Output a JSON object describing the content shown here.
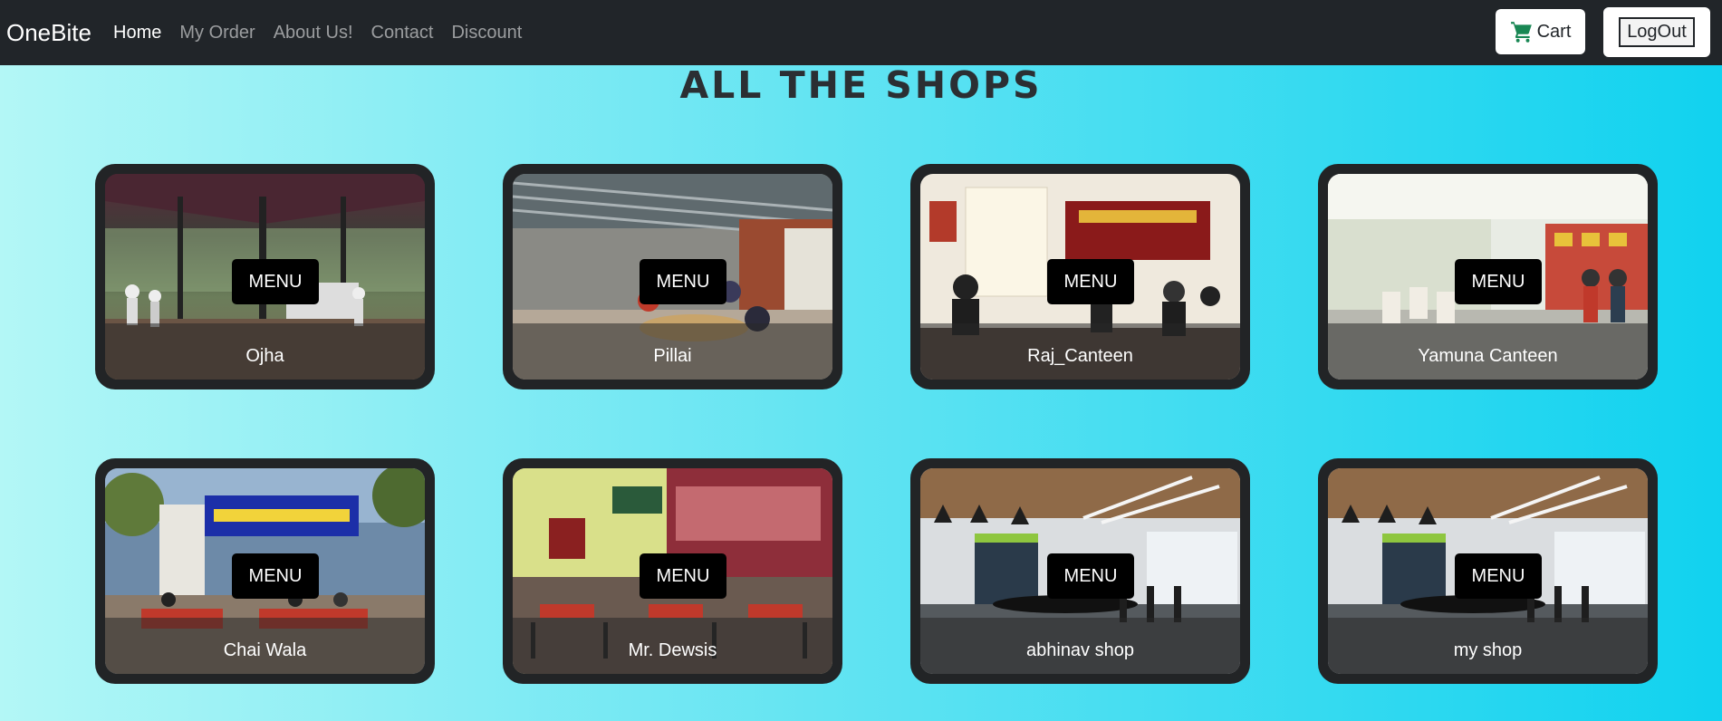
{
  "navbar": {
    "brand": "OneBite",
    "links": [
      {
        "label": "Home",
        "active": true
      },
      {
        "label": "My Order",
        "active": false
      },
      {
        "label": "About Us!",
        "active": false
      },
      {
        "label": "Contact",
        "active": false
      },
      {
        "label": "Discount",
        "active": false
      }
    ],
    "cart_label": "Cart",
    "cart_icon": "shopping-cart-icon",
    "logout_label": "LogOut"
  },
  "heading": "ALL THE SHOPS",
  "menu_label": "MENU",
  "shops": [
    {
      "name": "Ojha"
    },
    {
      "name": "Pillai"
    },
    {
      "name": "Raj_Canteen"
    },
    {
      "name": "Yamuna Canteen"
    },
    {
      "name": "Chai Wala"
    },
    {
      "name": "Mr. Dewsis"
    },
    {
      "name": "abhinav shop"
    },
    {
      "name": "my shop"
    }
  ],
  "colors": {
    "navbar_bg": "#212529",
    "card_bg": "#222426",
    "cart_icon_color": "#198754",
    "gradient_start": "#b3f7f6",
    "gradient_end": "#11d2ef"
  }
}
